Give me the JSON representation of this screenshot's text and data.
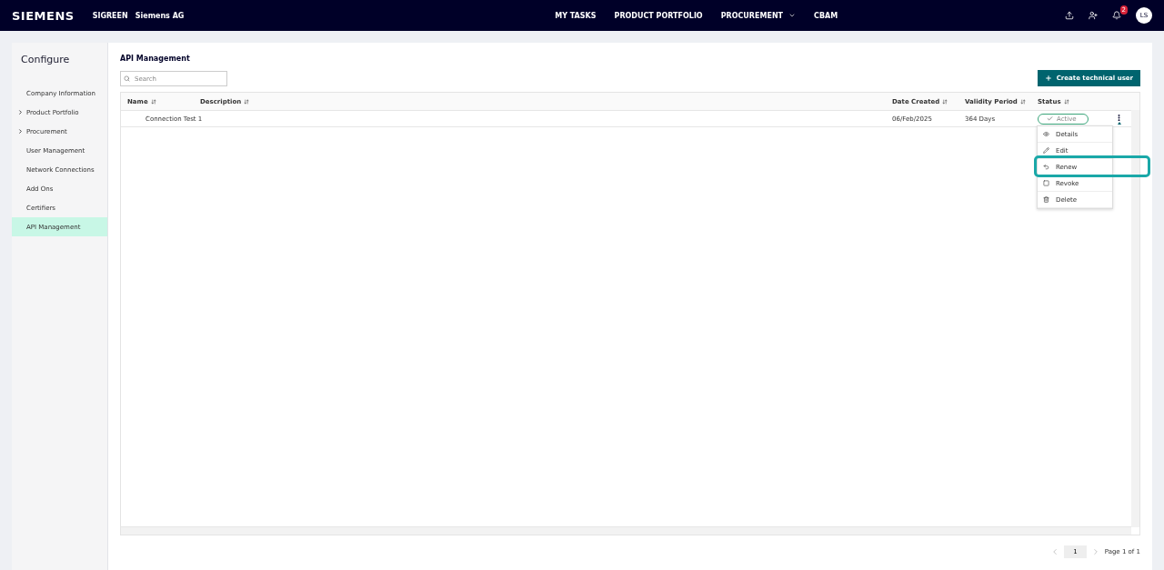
{
  "header": {
    "brand": "SIEMENS",
    "app": "SIGREEN",
    "org": "Siemens AG",
    "nav": [
      {
        "label": "MY TASKS",
        "dropdown": false
      },
      {
        "label": "PRODUCT PORTFOLIO",
        "dropdown": false
      },
      {
        "label": "PROCUREMENT",
        "dropdown": true
      },
      {
        "label": "CBAM",
        "dropdown": false
      }
    ],
    "notification_count": "2",
    "avatar": "LS"
  },
  "sidebar": {
    "title": "Configure",
    "items": [
      {
        "label": "Company Information",
        "expandable": false,
        "selected": false
      },
      {
        "label": "Product Portfolio",
        "expandable": true,
        "selected": false
      },
      {
        "label": "Procurement",
        "expandable": true,
        "selected": false
      },
      {
        "label": "User Management",
        "expandable": false,
        "selected": false
      },
      {
        "label": "Network Connections",
        "expandable": false,
        "selected": false
      },
      {
        "label": "Add Ons",
        "expandable": false,
        "selected": false
      },
      {
        "label": "Certifiers",
        "expandable": false,
        "selected": false
      },
      {
        "label": "API Management",
        "expandable": false,
        "selected": true
      }
    ]
  },
  "page": {
    "title": "API Management",
    "search": {
      "placeholder": "Search"
    },
    "create_button": "Create technical user",
    "table": {
      "columns": [
        {
          "label": "Name",
          "kind": "name"
        },
        {
          "label": "Description",
          "kind": "description"
        },
        {
          "label": "Date Created",
          "kind": "date"
        },
        {
          "label": "Validity Period",
          "kind": "validity"
        },
        {
          "label": "Status",
          "kind": "status"
        }
      ],
      "rows": [
        {
          "name": "Connection Test 1",
          "date": "06/Feb/2025",
          "validity": "364 Days",
          "status": "Active"
        }
      ]
    },
    "row_menu": [
      {
        "label": "Details",
        "kind": "eye",
        "highlighted": false
      },
      {
        "label": "Edit",
        "kind": "pencil",
        "highlighted": false
      },
      {
        "label": "Renew",
        "kind": "undo",
        "highlighted": true
      },
      {
        "label": "Revoke",
        "kind": "square",
        "highlighted": false
      },
      {
        "label": "Delete",
        "kind": "trash",
        "highlighted": false
      }
    ],
    "pagination": {
      "page": "1",
      "label": "Page 1 of 1"
    }
  }
}
